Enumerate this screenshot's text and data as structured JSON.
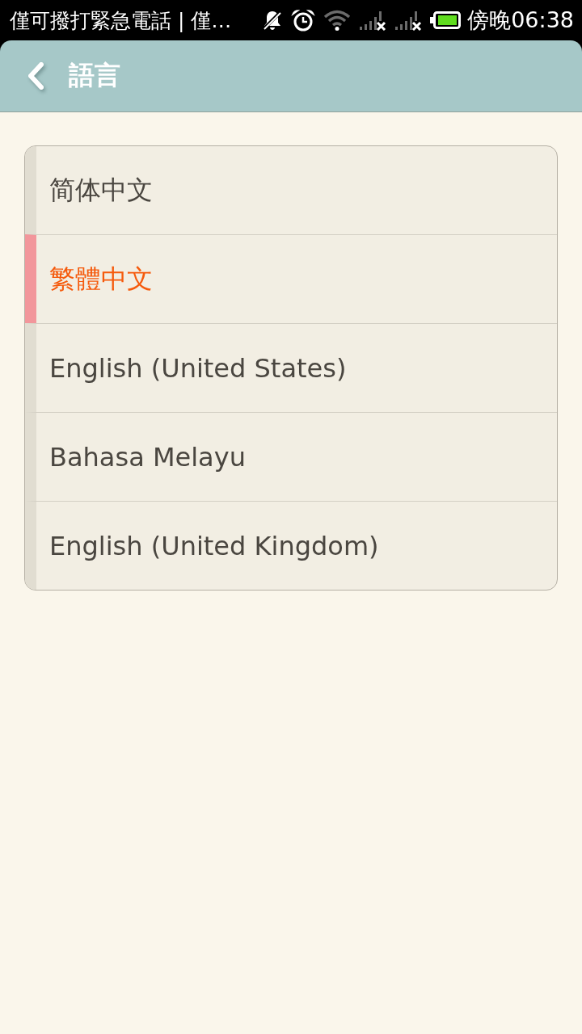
{
  "status_bar": {
    "notification": "僅可撥打緊急電話 | 僅…",
    "time": "傍晚06:38"
  },
  "header": {
    "title": "語言"
  },
  "languages": [
    {
      "label": "简体中文",
      "selected": false
    },
    {
      "label": "繁體中文",
      "selected": true
    },
    {
      "label": "English (United States)",
      "selected": false
    },
    {
      "label": "Bahasa Melayu",
      "selected": false
    },
    {
      "label": "English (United Kingdom)",
      "selected": false
    }
  ]
}
